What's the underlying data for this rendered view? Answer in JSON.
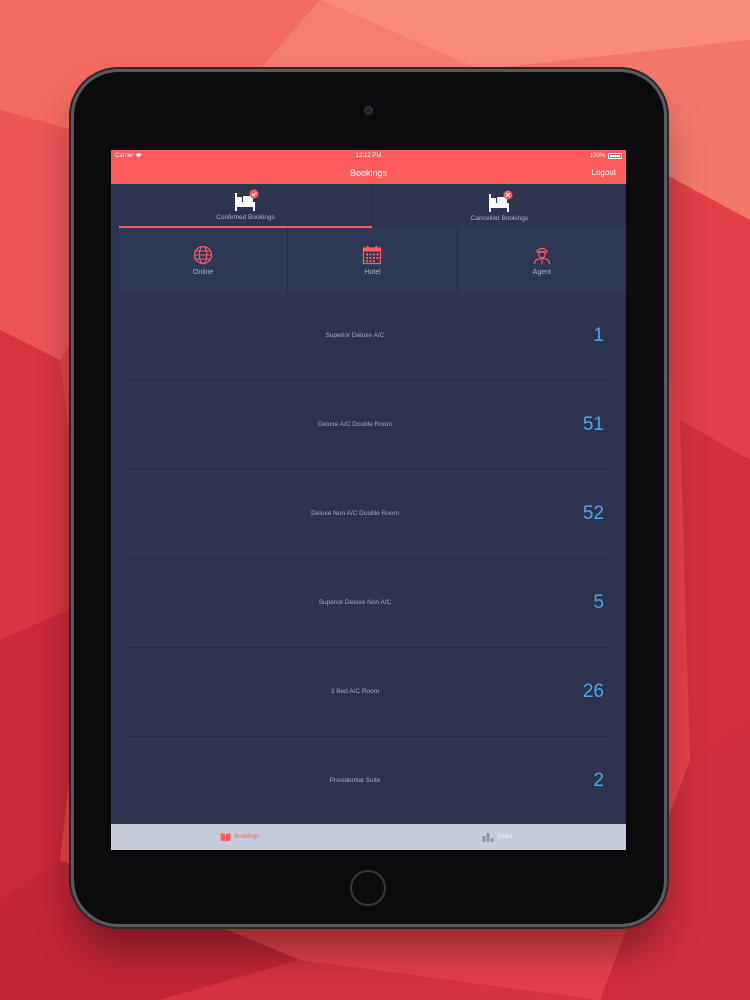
{
  "status_bar": {
    "carrier": "Carrier",
    "time": "12:12 PM",
    "battery": "100%"
  },
  "nav": {
    "title": "Bookings",
    "logout_label": "Logout"
  },
  "segments": [
    {
      "label": "Confirmed Bookings",
      "icon": "bed-check-icon"
    },
    {
      "label": "Cancelled Bookings",
      "icon": "bed-cancel-icon"
    }
  ],
  "channels": [
    {
      "label": "Online",
      "icon": "globe-icon"
    },
    {
      "label": "Hotel",
      "icon": "calendar-icon"
    },
    {
      "label": "Agent",
      "icon": "agent-icon"
    }
  ],
  "rooms": [
    {
      "name": "Superior Deluxe A/C",
      "count": "1"
    },
    {
      "name": "Deluxe A/C Double Room",
      "count": "51"
    },
    {
      "name": "Deluxe Non A/C Double Room",
      "count": "52"
    },
    {
      "name": "Superior Deluxe Non A/C",
      "count": "5"
    },
    {
      "name": "3 Bed A/C Room",
      "count": "26"
    },
    {
      "name": "Presidential Suite",
      "count": "2"
    }
  ],
  "tabs": [
    {
      "label": "Bookings",
      "icon": "book-icon"
    },
    {
      "label": "Sales",
      "icon": "bar-chart-icon"
    }
  ],
  "colors": {
    "accent": "#ff5b5f",
    "panel": "#2c3450",
    "count": "#4fa3e8",
    "tabbar": "#c5ccd9"
  }
}
